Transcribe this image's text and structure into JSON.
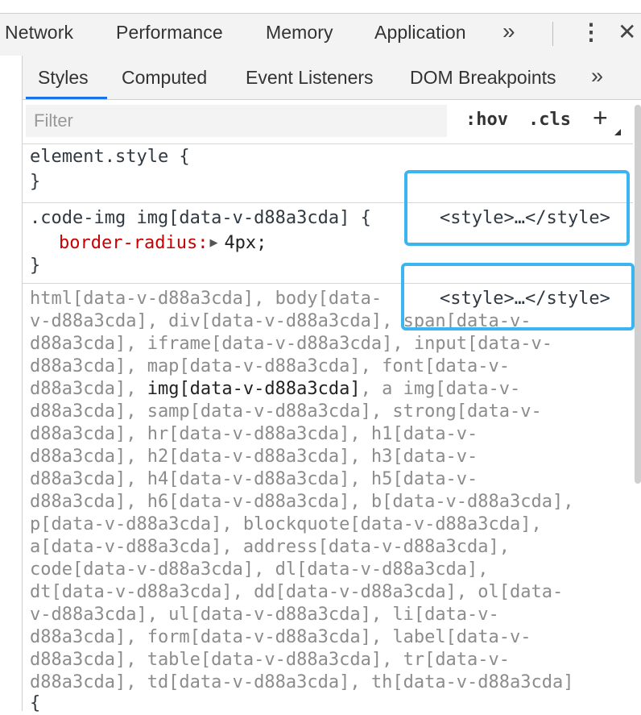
{
  "main_tabs": {
    "network": "Network",
    "performance": "Performance",
    "memory": "Memory",
    "application": "Application",
    "more": "»",
    "kebab": "⋮",
    "close": "✕"
  },
  "sub_tabs": {
    "styles": "Styles",
    "computed": "Computed",
    "event_listeners": "Event Listeners",
    "dom_breakpoints": "DOM Breakpoints",
    "more": "»"
  },
  "filter": {
    "placeholder": "Filter",
    "hov": ":hov",
    "cls": ".cls",
    "plus": "+"
  },
  "rules": {
    "element_style": {
      "selector": "element.style {",
      "close": "}"
    },
    "code_img": {
      "selector": ".code-img img[data-v-d88a3cda] {",
      "source": "<style>…</style>",
      "property": "border-radius",
      "colon": ":",
      "value": "4px;",
      "close": "}"
    },
    "reset": {
      "source": "<style>…</style>",
      "selector_lines": [
        "html[data-v-d88a3cda], body[data-",
        "v-d88a3cda], div[data-v-d88a3cda], span[data-v-",
        "d88a3cda], iframe[data-v-d88a3cda], input[data-v-",
        "d88a3cda], map[data-v-d88a3cda], font[data-v-",
        "d88a3cda], ",
        "img[data-v-d88a3cda]",
        ", a img[data-v-",
        "d88a3cda], samp[data-v-d88a3cda], strong[data-v-",
        "d88a3cda], hr[data-v-d88a3cda], h1[data-v-",
        "d88a3cda], h2[data-v-d88a3cda], h3[data-v-",
        "d88a3cda], h4[data-v-d88a3cda], h5[data-v-",
        "d88a3cda], h6[data-v-d88a3cda], b[data-v-d88a3cda],",
        "p[data-v-d88a3cda], blockquote[data-v-d88a3cda],",
        "a[data-v-d88a3cda], address[data-v-d88a3cda],",
        "code[data-v-d88a3cda], dl[data-v-d88a3cda],",
        "dt[data-v-d88a3cda], dd[data-v-d88a3cda], ol[data-",
        "v-d88a3cda], ul[data-v-d88a3cda], li[data-v-",
        "d88a3cda], form[data-v-d88a3cda], label[data-v-",
        "d88a3cda], table[data-v-d88a3cda], tr[data-v-",
        "d88a3cda], td[data-v-d88a3cda], th[data-v-d88a3cda]",
        "{"
      ]
    }
  },
  "colors": {
    "active_tab_underline": "#1a73e8",
    "highlight_box": "#3bb5f0",
    "property_name": "#c80000"
  }
}
